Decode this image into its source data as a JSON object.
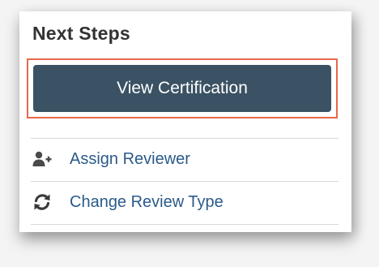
{
  "panel": {
    "title": "Next Steps",
    "primary_button": {
      "label": "View Certification",
      "background_color": "#3b5264",
      "highlight_color": "#e8684a"
    },
    "items": [
      {
        "label": "Assign Reviewer",
        "icon": "assign-reviewer-icon"
      },
      {
        "label": "Change Review Type",
        "icon": "refresh-icon"
      }
    ],
    "link_color": "#2b5a8a"
  }
}
